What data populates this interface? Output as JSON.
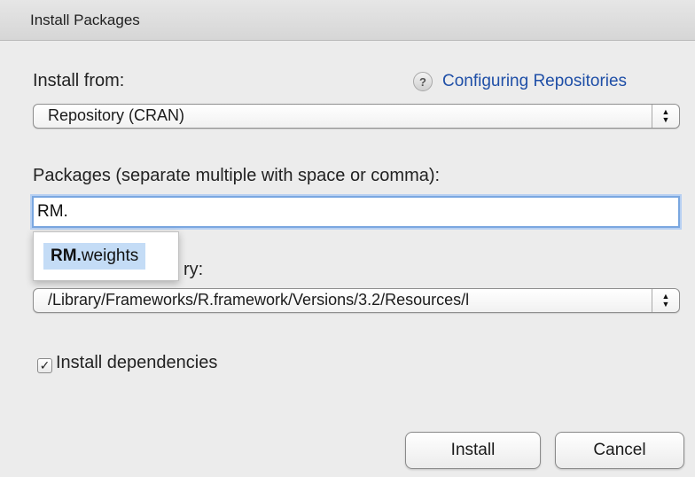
{
  "window": {
    "title": "Install Packages"
  },
  "install_from": {
    "label": "Install from:",
    "selected": "Repository (CRAN)"
  },
  "help": {
    "icon": "?",
    "link": "Configuring Repositories"
  },
  "packages": {
    "label": "Packages (separate multiple with space or comma):",
    "value": "RM."
  },
  "autocomplete": {
    "match": "RM.",
    "rest": "weights"
  },
  "library": {
    "label_visible_tail": "ry:",
    "selected": "/Library/Frameworks/R.framework/Versions/3.2/Resources/l"
  },
  "dependencies": {
    "label": "Install dependencies",
    "checked": true,
    "check_glyph": "✓"
  },
  "buttons": {
    "install": "Install",
    "cancel": "Cancel"
  },
  "colors": {
    "link": "#1f4fa7",
    "focus_ring": "#7aa7e0",
    "highlight": "#c4dcf6"
  }
}
